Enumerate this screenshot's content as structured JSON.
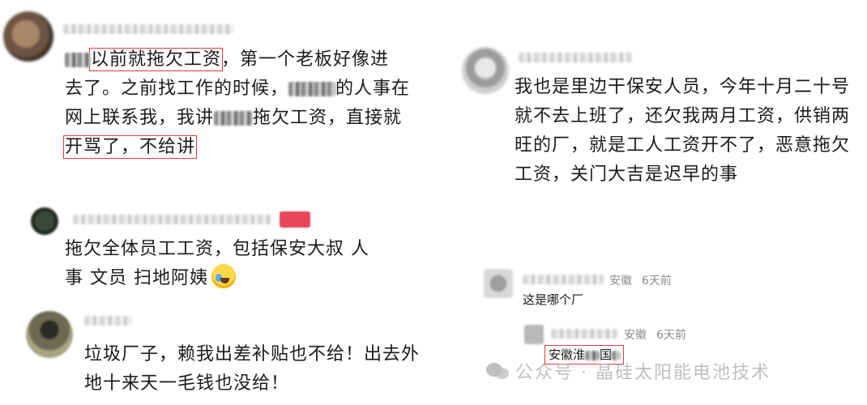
{
  "comments": [
    {
      "id": "c1",
      "lines": [
        {
          "pre_blur": true,
          "highlight": "以前就拖欠工资",
          "rest": "，第一个老板好像进"
        },
        {
          "text_a": "去了。之前找工作的时候，",
          "blur": true,
          "text_b": "的人事在"
        },
        {
          "text_a": "网上联系我，我讲",
          "blur": true,
          "text_b": "拖欠工资，直接就"
        },
        {
          "highlight": "开骂了，不给讲"
        }
      ]
    },
    {
      "id": "c2",
      "lines": [
        "我也是里边干保安人员，今年十月二十号",
        "就不去上班了，还欠我两月工资，供销两",
        "旺的厂，就是工人工资开不了，恶意拖欠",
        "工资，关门大吉是迟早的事"
      ]
    },
    {
      "id": "c3",
      "lines": [
        "拖欠全体员工工资，包括保安大叔 人",
        "事 文员 扫地阿姨"
      ],
      "emoji": "crying-laughing-emoji"
    },
    {
      "id": "c4",
      "lines": [
        "垃圾厂子，赖我出差补贴也不给！出去外",
        "地十来天一毛钱也没给！"
      ]
    },
    {
      "id": "c5",
      "location": "安徽",
      "time": "6天前",
      "text": "这是哪个厂"
    },
    {
      "id": "c6",
      "location": "安徽",
      "time": "6天前",
      "text_a": "安徽淮",
      "text_b": "国",
      "highlighted": true
    }
  ],
  "watermark": {
    "icon": "wechat-icon",
    "text": "公众号 · 晶硅太阳能电池技术"
  },
  "colors": {
    "highlight_border": "#e23b3b",
    "meta_gray": "#8a8a8a",
    "author_badge": "#e8455a"
  }
}
